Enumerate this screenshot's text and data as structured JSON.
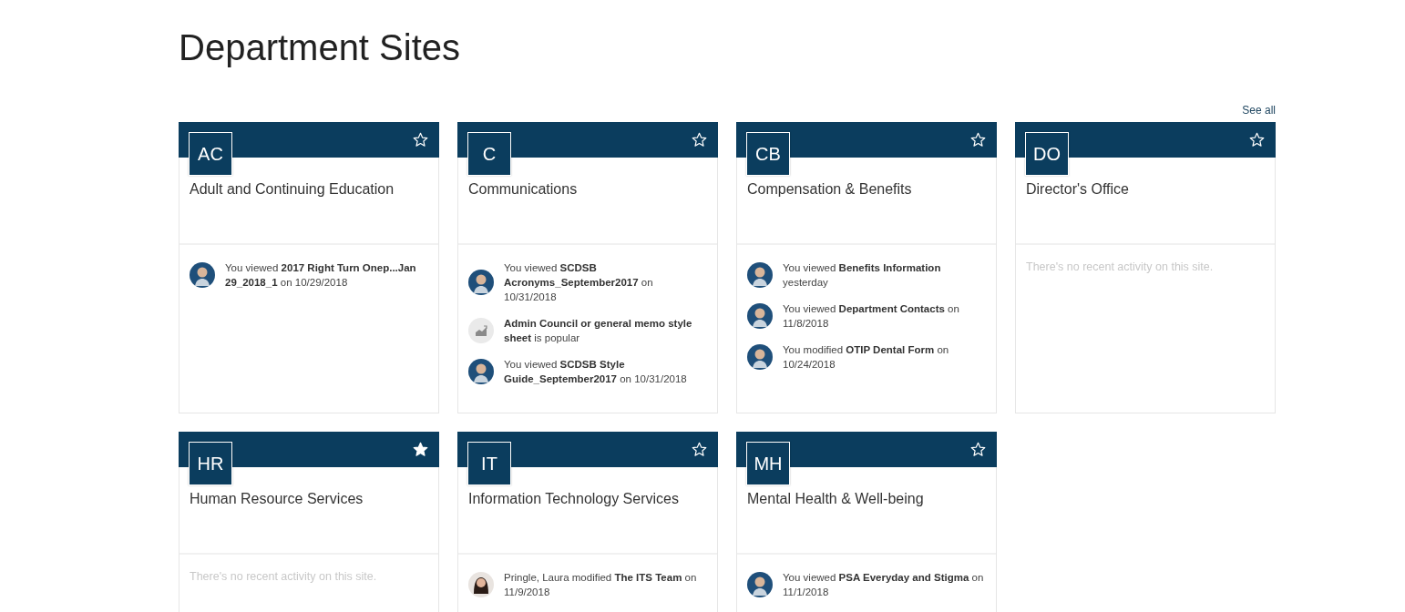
{
  "page_title": "Department Sites",
  "see_all": "See all",
  "sites": [
    {
      "initials": "AC",
      "name": "Adult and Continuing Education",
      "favorite": false,
      "activity": [
        {
          "kind": "person",
          "text": "You viewed **2017 Right Turn Onep...Jan 29_2018_1** on 10/29/2018"
        }
      ]
    },
    {
      "initials": "C",
      "name": "Communications",
      "favorite": false,
      "activity": [
        {
          "kind": "person",
          "text": "You viewed **SCDSB Acronyms_September2017** on 10/31/2018"
        },
        {
          "kind": "trending",
          "text": "**Admin Council or general memo style sheet** is popular"
        },
        {
          "kind": "person",
          "text": "You viewed **SCDSB Style Guide_September2017** on 10/31/2018"
        }
      ]
    },
    {
      "initials": "CB",
      "name": "Compensation & Benefits",
      "favorite": false,
      "activity": [
        {
          "kind": "person",
          "text": "You viewed **Benefits Information** yesterday"
        },
        {
          "kind": "person",
          "text": "You viewed **Department Contacts** on 11/8/2018"
        },
        {
          "kind": "person",
          "text": "You modified **OTIP Dental Form** on 10/24/2018"
        }
      ]
    },
    {
      "initials": "DO",
      "name": "Director's Office",
      "favorite": false,
      "empty_message": "There's no recent activity on this site."
    },
    {
      "initials": "HR",
      "name": "Human Resource Services",
      "favorite": true,
      "empty_message": "There's no recent activity on this site."
    },
    {
      "initials": "IT",
      "name": "Information Technology Services",
      "favorite": false,
      "activity": [
        {
          "kind": "person-long-hair",
          "text": "Pringle, Laura modified **The ITS Team** on 11/9/2018"
        }
      ]
    },
    {
      "initials": "MH",
      "name": "Mental Health & Well-being",
      "favorite": false,
      "activity": [
        {
          "kind": "person",
          "text": "You viewed **PSA Everyday and Stigma** on 11/1/2018"
        }
      ]
    }
  ]
}
